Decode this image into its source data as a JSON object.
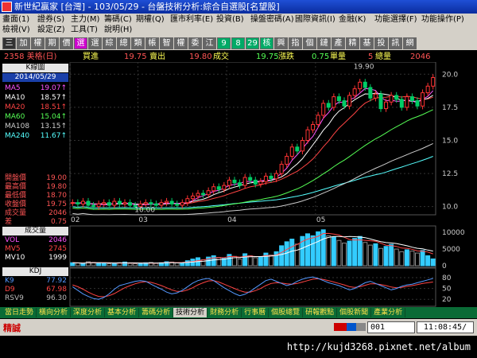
{
  "window": {
    "title": "新世紀贏家 [台灣] - 103/05/29 - 台盤技術分析:綜合自選股[名望股]"
  },
  "menu": {
    "row1": [
      "畫面(1)",
      "證券(S)",
      "主力(M)",
      "籌碼(C)",
      "期權(Q)",
      "匯市利率(E)",
      "投資(B)",
      "操盤密碼(A)",
      "國際資訊(I)",
      "金融(K)",
      "功能選擇(F)",
      "功能操作(P)"
    ],
    "row2": [
      "檢視(V)",
      "設定(Z)",
      "工具(T)",
      "說明(H)"
    ]
  },
  "toolbar": [
    "三",
    "加",
    "權",
    "期",
    "價",
    "選",
    "選",
    "綜",
    "總",
    "類",
    "帳",
    "智",
    "權",
    "委",
    "江",
    "9",
    "8",
    "29",
    "核",
    "興",
    "指",
    "個",
    "鏈",
    "產",
    "精",
    "基",
    "投",
    "訊",
    "網"
  ],
  "quote": {
    "stock": "2358 美格(日)",
    "buy_label": "買進",
    "buy": "19.75",
    "sell_label": "賣出",
    "sell": "19.80",
    "deal_label": "成交",
    "deal": "19.75",
    "change_label": "漲跌",
    "change": "0.75",
    "vol_label": "單量",
    "vol": "5",
    "total_label": "總量",
    "total": "2046"
  },
  "left_panel": {
    "header": "K線圖",
    "date": "2014/05/29",
    "ma": [
      {
        "name": "MA5",
        "value": "19.07↑",
        "color": "#ff55ff"
      },
      {
        "name": "MA10",
        "value": "18.57↑",
        "color": "#ffffff"
      },
      {
        "name": "MA20",
        "value": "18.51↑",
        "color": "#ff4444"
      },
      {
        "name": "MA60",
        "value": "15.04↑",
        "color": "#55ff55"
      },
      {
        "name": "MA108",
        "value": "13.15↑",
        "color": "#cccccc"
      },
      {
        "name": "MA240",
        "value": "11.67↑",
        "color": "#55ffff"
      }
    ],
    "ohlc": [
      {
        "name": "開盤價",
        "value": "19.00"
      },
      {
        "name": "最高價",
        "value": "19.80"
      },
      {
        "name": "最低價",
        "value": "18.70"
      },
      {
        "name": "收盤價",
        "value": "19.75"
      },
      {
        "name": "成交量",
        "value": "2046"
      },
      {
        "name": "差",
        "value": "0.75"
      }
    ]
  },
  "volume_panel": {
    "header": "成交量",
    "rows": [
      {
        "name": "VOL",
        "value": "2046",
        "color": "#ff55ff"
      },
      {
        "name": "MV5",
        "value": "2745",
        "color": "#ff4444"
      },
      {
        "name": "MV10",
        "value": "1999",
        "color": "#ffffff"
      }
    ]
  },
  "kd_panel": {
    "header": "KDJ",
    "rows": [
      {
        "name": "K9",
        "value": "77.92",
        "color": "#5599ff"
      },
      {
        "name": "D9",
        "value": "67.98",
        "color": "#ff4444"
      },
      {
        "name": "RSV9",
        "value": "96.30",
        "color": "#bbbbbb"
      }
    ]
  },
  "bottom_tabs": [
    "當日走勢",
    "橫向分析",
    "深度分析",
    "基本分析",
    "籌碼分析",
    "技術分析",
    "財務分析",
    "行事曆",
    "個股總覽",
    "研報觀點",
    "個股新聞",
    "產業分析"
  ],
  "active_tab": 5,
  "status": {
    "label": "精誠",
    "code": "001",
    "clock": "11:08:45/"
  },
  "url": "http://kujd3268.pixnet.net/album",
  "chart_data": [
    {
      "type": "candlestick",
      "x_ticks": [
        "02",
        "03",
        "04",
        "05"
      ],
      "y_ticks": [
        10.0,
        12.5,
        15.0,
        17.5,
        20.0
      ],
      "ylim": [
        9.5,
        20.8
      ],
      "annotations": [
        "19.90",
        "10.00"
      ],
      "close": [
        10.3,
        10.2,
        10.4,
        10.1,
        10.0,
        10.2,
        10.3,
        10.1,
        10.4,
        10.2,
        10.3,
        10.1,
        10.0,
        10.2,
        10.3,
        10.2,
        10.1,
        10.3,
        10.4,
        10.2,
        10.1,
        10.3,
        10.6,
        10.8,
        11.0,
        10.9,
        11.2,
        11.5,
        11.3,
        11.6,
        12.0,
        11.8,
        11.6,
        12.2,
        12.0,
        11.7,
        11.9,
        12.3,
        12.1,
        12.5,
        13.2,
        13.8,
        14.5,
        14.2,
        15.0,
        15.8,
        16.2,
        16.9,
        17.8,
        17.5,
        18.3,
        18.0,
        17.6,
        18.4,
        18.9,
        19.4,
        19.0,
        18.2,
        18.5,
        17.4,
        17.9,
        18.4,
        18.1,
        17.5,
        18.3,
        18.0,
        17.6,
        18.6,
        19.1,
        19.75
      ]
    },
    {
      "type": "bar",
      "name": "成交量",
      "y_ticks": [
        0,
        5000,
        10000
      ],
      "ylim": [
        0,
        11000
      ],
      "values": [
        900,
        800,
        700,
        1200,
        1000,
        900,
        700,
        600,
        800,
        900,
        1100,
        700,
        600,
        800,
        900,
        1000,
        700,
        900,
        1200,
        1100,
        800,
        900,
        1500,
        2000,
        2400,
        1800,
        2600,
        3000,
        2500,
        2200,
        3400,
        2800,
        2000,
        3600,
        3000,
        2400,
        2600,
        3800,
        3200,
        4200,
        6000,
        7200,
        8000,
        6500,
        8800,
        9600,
        9000,
        10200,
        10800,
        9000,
        8600,
        7600,
        6800,
        7400,
        8200,
        8800,
        7000,
        6200,
        6600,
        5200,
        5800,
        6400,
        5000,
        4200,
        4800,
        4400,
        3800,
        4600,
        3000,
        2046
      ]
    },
    {
      "type": "line",
      "name": "KDJ",
      "y_ticks": [
        20,
        50,
        80
      ],
      "ylim": [
        5,
        100
      ],
      "series": [
        {
          "name": "K9",
          "values": [
            55,
            45,
            35,
            28,
            22,
            20,
            25,
            35,
            48,
            58,
            62,
            66,
            70,
            72,
            70,
            62,
            55,
            48,
            40,
            35,
            38,
            45,
            55,
            65,
            72,
            76,
            78,
            72,
            62,
            52,
            44,
            36,
            30,
            34,
            42,
            52,
            62,
            72,
            76,
            70,
            64,
            58,
            62,
            70,
            76,
            80,
            82,
            78,
            72,
            66,
            62,
            58,
            52,
            46,
            50,
            58,
            66,
            70,
            64,
            58,
            52,
            46,
            50,
            56,
            60,
            62,
            66,
            70,
            74,
            77.92
          ]
        },
        {
          "name": "D9",
          "values": [
            60,
            55,
            48,
            40,
            33,
            28,
            27,
            30,
            36,
            44,
            52,
            58,
            63,
            67,
            69,
            67,
            63,
            58,
            52,
            46,
            42,
            42,
            46,
            52,
            60,
            66,
            71,
            72,
            68,
            62,
            56,
            50,
            44,
            40,
            40,
            44,
            50,
            58,
            64,
            66,
            65,
            63,
            62,
            64,
            68,
            72,
            76,
            77,
            75,
            72,
            68,
            64,
            60,
            55,
            53,
            55,
            59,
            63,
            63,
            61,
            58,
            54,
            52,
            53,
            56,
            58,
            61,
            64,
            66,
            67.98
          ]
        }
      ]
    }
  ]
}
